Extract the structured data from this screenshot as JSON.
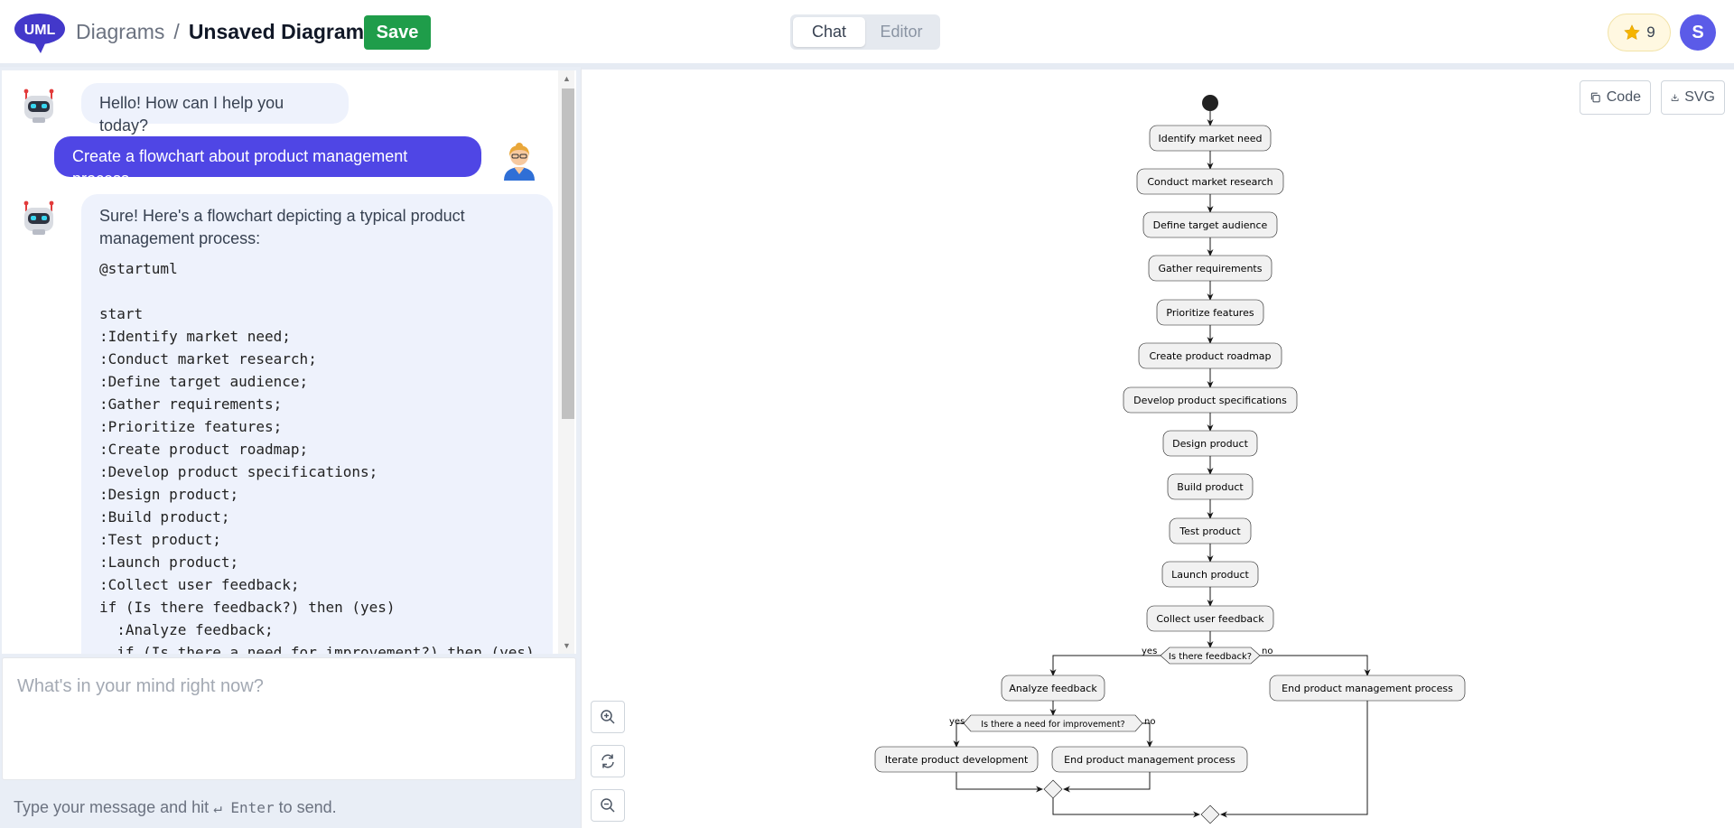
{
  "header": {
    "logo_text": "UML",
    "breadcrumb_root": "Diagrams",
    "breadcrumb_sep": "/",
    "title": "Unsaved Diagram",
    "save_label": "Save",
    "view_tabs": [
      {
        "label": "Chat",
        "active": true
      },
      {
        "label": "Editor",
        "active": false
      }
    ],
    "stars_count": "9",
    "user_initial": "S",
    "accent_color": "#4f46e5",
    "save_color": "#1f9d4a"
  },
  "chat": {
    "messages": [
      {
        "role": "bot",
        "text": "Hello! How can I help you today?"
      },
      {
        "role": "user",
        "text": "Create a flowchart about product management process."
      },
      {
        "role": "bot",
        "text": "Sure! Here's a flowchart depicting a typical product management process:",
        "code": "@startuml\n\nstart\n:Identify market need;\n:Conduct market research;\n:Define target audience;\n:Gather requirements;\n:Prioritize features;\n:Create product roadmap;\n:Develop product specifications;\n:Design product;\n:Build product;\n:Test product;\n:Launch product;\n:Collect user feedback;\nif (Is there feedback?) then (yes)\n  :Analyze feedback;\n  if (Is there a need for improvement?) then (yes)"
      }
    ],
    "input_placeholder": "What's in your mind right now?",
    "hint_before": "Type your message and hit",
    "hint_key": "↵ Enter",
    "hint_after": "to send."
  },
  "diagram": {
    "code_label": "Code",
    "svg_label": "SVG",
    "icons": [
      "copy-icon",
      "download-icon",
      "zoom-in-icon",
      "reset-icon",
      "zoom-out-icon"
    ],
    "steps": [
      "Identify market need",
      "Conduct market research",
      "Define target audience",
      "Gather requirements",
      "Prioritize features",
      "Create product roadmap",
      "Develop product specifications",
      "Design product",
      "Build product",
      "Test product",
      "Launch product",
      "Collect user feedback"
    ],
    "decision1": "Is there feedback?",
    "decision1_yes": "yes",
    "decision1_no": "no",
    "analyze": "Analyze feedback",
    "end_right": "End product management process",
    "decision2": "Is there a need for improvement?",
    "decision2_yes": "yes",
    "decision2_no": "no",
    "iterate": "Iterate product development",
    "end_inner": "End product management process"
  }
}
